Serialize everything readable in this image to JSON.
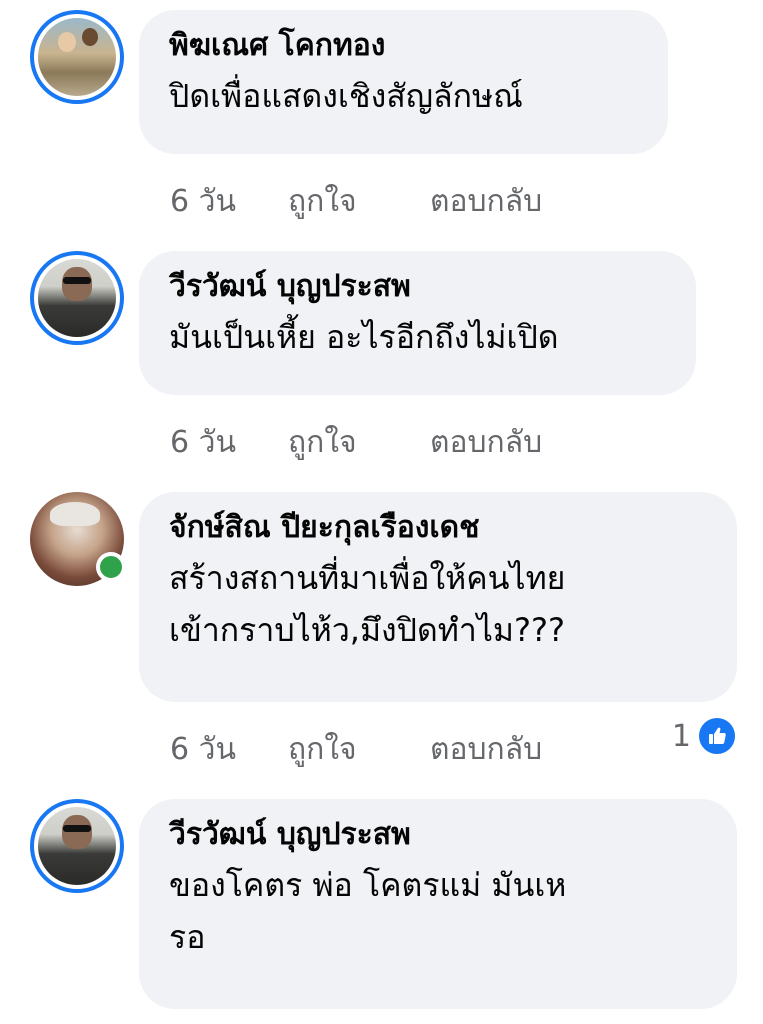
{
  "comments": [
    {
      "author": "พิฆเณศ โคกทอง",
      "lines": [
        "ปิดเพื่อแสดงเชิงสัญลักษณ์"
      ],
      "time": "6 วัน",
      "like": "ถูกใจ",
      "reply": "ตอบกลับ"
    },
    {
      "author": "วีรวัฒน์ บุญประสพ",
      "lines": [
        "มันเป็นเหี้ย  อะไรอีกถึงไม่เปิด"
      ],
      "time": "6 วัน",
      "like": "ถูกใจ",
      "reply": "ตอบกลับ"
    },
    {
      "author": "จักษ์สิณ ปียะกุลเรืองเดช",
      "lines": [
        "สร้างสถานที่มาเพื่อให้คนไทย",
        "เข้ากราบไห้ว,มึงปิดทำไม???"
      ],
      "time": "6 วัน",
      "like": "ถูกใจ",
      "reply": "ตอบกลับ",
      "reaction_count": "1"
    },
    {
      "author": "วีรวัฒน์ บุญประสพ",
      "lines": [
        "ของโคตร พ่อ  โคตรแม่  มันเห",
        "รอ"
      ]
    }
  ],
  "colors": {
    "bubble": "#f0f2f5",
    "story_ring": "#1877f2",
    "online": "#31a24c",
    "meta_text": "#65676b",
    "like_badge": "#1877f2"
  },
  "icons": {
    "reaction": "like-thumb-icon"
  }
}
